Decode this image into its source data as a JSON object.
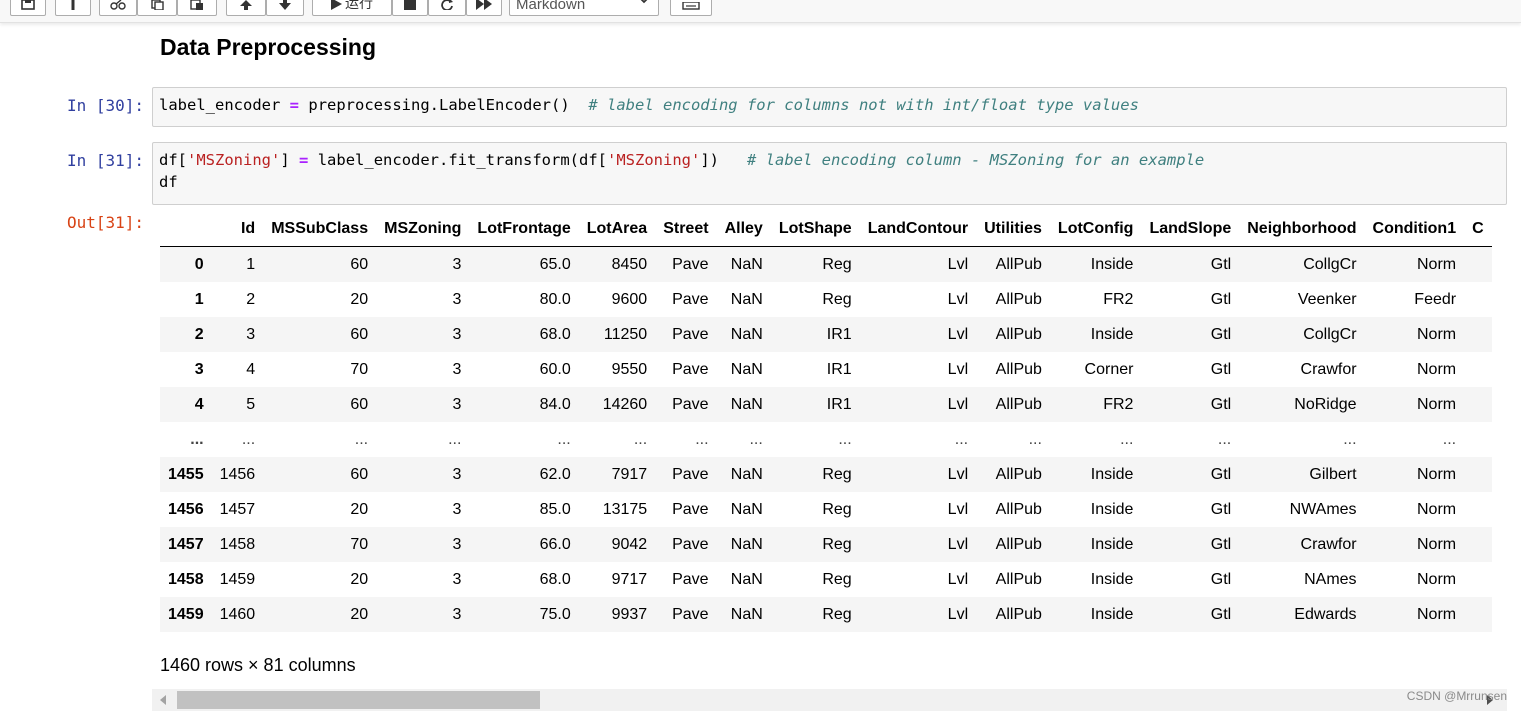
{
  "toolbar": {
    "buttons": [
      "save",
      "add-cell",
      "cut",
      "copy",
      "paste",
      "move-up",
      "move-down",
      "run",
      "interrupt",
      "restart",
      "restart-run-all",
      "command-palette"
    ],
    "run_label": "运行",
    "cell_type": "Markdown"
  },
  "heading": "Data Preprocessing",
  "cells": [
    {
      "prompt": "In  [30]:",
      "code_var": "label_encoder",
      "code_op": "=",
      "code_rhs": "preprocessing.LabelEncoder()",
      "comment": "# label encoding for columns not with int/float type values"
    },
    {
      "prompt": "In  [31]:",
      "line1_a": "df[",
      "line1_str1": "'MSZoning'",
      "line1_b": "]",
      "line1_op": "=",
      "line1_c": "label_encoder.fit_transform(df[",
      "line1_str2": "'MSZoning'",
      "line1_d": "])",
      "comment": "# label encoding column - MSZoning for an example",
      "line2": "df"
    }
  ],
  "output": {
    "prompt": "Out[31]:",
    "columns": [
      "",
      "Id",
      "MSSubClass",
      "MSZoning",
      "LotFrontage",
      "LotArea",
      "Street",
      "Alley",
      "LotShape",
      "LandContour",
      "Utilities",
      "LotConfig",
      "LandSlope",
      "Neighborhood",
      "Condition1",
      "C"
    ],
    "rows": [
      [
        "0",
        "1",
        "60",
        "3",
        "65.0",
        "8450",
        "Pave",
        "NaN",
        "Reg",
        "Lvl",
        "AllPub",
        "Inside",
        "Gtl",
        "CollgCr",
        "Norm",
        ""
      ],
      [
        "1",
        "2",
        "20",
        "3",
        "80.0",
        "9600",
        "Pave",
        "NaN",
        "Reg",
        "Lvl",
        "AllPub",
        "FR2",
        "Gtl",
        "Veenker",
        "Feedr",
        ""
      ],
      [
        "2",
        "3",
        "60",
        "3",
        "68.0",
        "11250",
        "Pave",
        "NaN",
        "IR1",
        "Lvl",
        "AllPub",
        "Inside",
        "Gtl",
        "CollgCr",
        "Norm",
        ""
      ],
      [
        "3",
        "4",
        "70",
        "3",
        "60.0",
        "9550",
        "Pave",
        "NaN",
        "IR1",
        "Lvl",
        "AllPub",
        "Corner",
        "Gtl",
        "Crawfor",
        "Norm",
        ""
      ],
      [
        "4",
        "5",
        "60",
        "3",
        "84.0",
        "14260",
        "Pave",
        "NaN",
        "IR1",
        "Lvl",
        "AllPub",
        "FR2",
        "Gtl",
        "NoRidge",
        "Norm",
        ""
      ],
      [
        "...",
        "...",
        "...",
        "...",
        "...",
        "...",
        "...",
        "...",
        "...",
        "...",
        "...",
        "...",
        "...",
        "...",
        "...",
        ""
      ],
      [
        "1455",
        "1456",
        "60",
        "3",
        "62.0",
        "7917",
        "Pave",
        "NaN",
        "Reg",
        "Lvl",
        "AllPub",
        "Inside",
        "Gtl",
        "Gilbert",
        "Norm",
        ""
      ],
      [
        "1456",
        "1457",
        "20",
        "3",
        "85.0",
        "13175",
        "Pave",
        "NaN",
        "Reg",
        "Lvl",
        "AllPub",
        "Inside",
        "Gtl",
        "NWAmes",
        "Norm",
        ""
      ],
      [
        "1457",
        "1458",
        "70",
        "3",
        "66.0",
        "9042",
        "Pave",
        "NaN",
        "Reg",
        "Lvl",
        "AllPub",
        "Inside",
        "Gtl",
        "Crawfor",
        "Norm",
        ""
      ],
      [
        "1458",
        "1459",
        "20",
        "3",
        "68.0",
        "9717",
        "Pave",
        "NaN",
        "Reg",
        "Lvl",
        "AllPub",
        "Inside",
        "Gtl",
        "NAmes",
        "Norm",
        ""
      ],
      [
        "1459",
        "1460",
        "20",
        "3",
        "75.0",
        "9937",
        "Pave",
        "NaN",
        "Reg",
        "Lvl",
        "AllPub",
        "Inside",
        "Gtl",
        "Edwards",
        "Norm",
        ""
      ]
    ],
    "shape": "1460 rows × 81 columns"
  },
  "watermark": "CSDN @Mrrunsen"
}
